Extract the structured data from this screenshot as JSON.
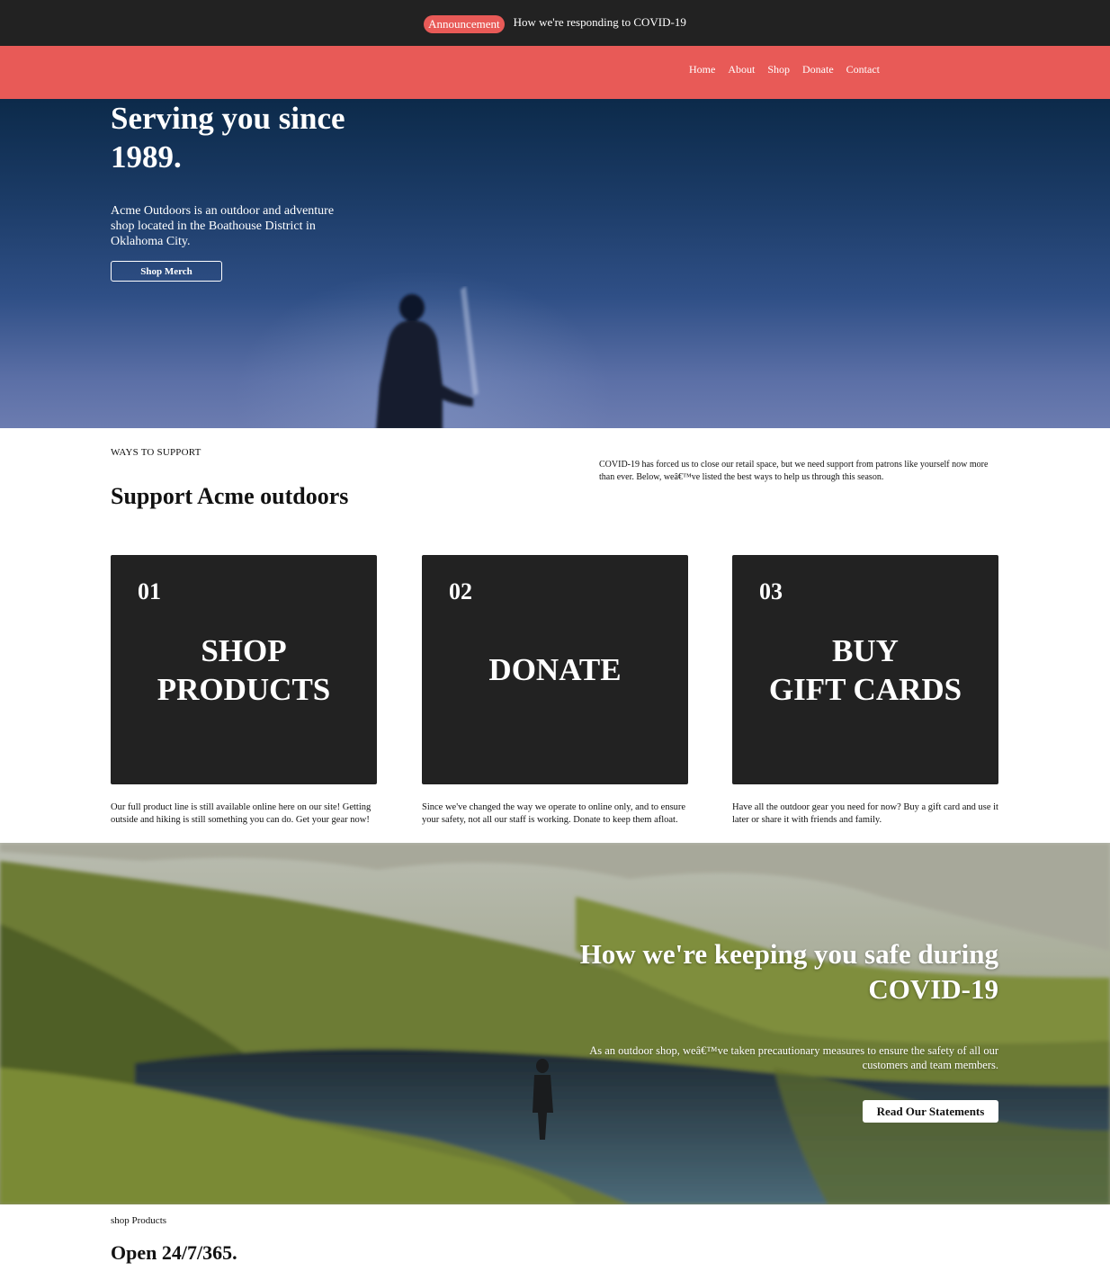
{
  "announcement": {
    "badge": "Announcement",
    "text": "How we're responding to COVID-19"
  },
  "nav": {
    "items": [
      {
        "label": "Home"
      },
      {
        "label": "About"
      },
      {
        "label": "Shop"
      },
      {
        "label": "Donate"
      },
      {
        "label": "Contact"
      }
    ]
  },
  "hero": {
    "title": "Serving you since 1989.",
    "description": "Acme Outdoors is an outdoor and adventure shop located in the Boathouse District in Oklahoma City.",
    "button_label": "Shop Merch"
  },
  "support": {
    "eyebrow": "WAYS TO SUPPORT",
    "title": "Support Acme outdoors",
    "intro": "COVID-19 has forced us to close our retail space, but we need support from patrons like yourself now more than ever. Below, weâ€™ve listed the best ways to help us through this season.",
    "cards": [
      {
        "number": "01",
        "label": "SHOP\nPRODUCTS",
        "description": "Our full product line is still available online here on our site! Getting outside and hiking is still something you can do. Get your gear now!"
      },
      {
        "number": "02",
        "label": "DONATE",
        "description": "Since we've changed the way we operate to online only, and to ensure your safety, not all our staff is working. Donate to keep them afloat."
      },
      {
        "number": "03",
        "label": "BUY\nGIFT CARDS",
        "description": "Have all the outdoor gear you need for now? Buy a gift card and use it later or share it with friends and family."
      }
    ]
  },
  "safety": {
    "title": "How we're keeping you safe during COVID-19",
    "description": "As an outdoor shop, weâ€™ve taken precautionary measures to ensure the safety of all our customers and team members.",
    "button_label": "Read Our Statements"
  },
  "shop": {
    "eyebrow": "shop Products",
    "title": "Open 24/7/365."
  },
  "colors": {
    "announcement_bg": "#222222",
    "accent": "#e85a57",
    "card_bg": "#222222"
  }
}
